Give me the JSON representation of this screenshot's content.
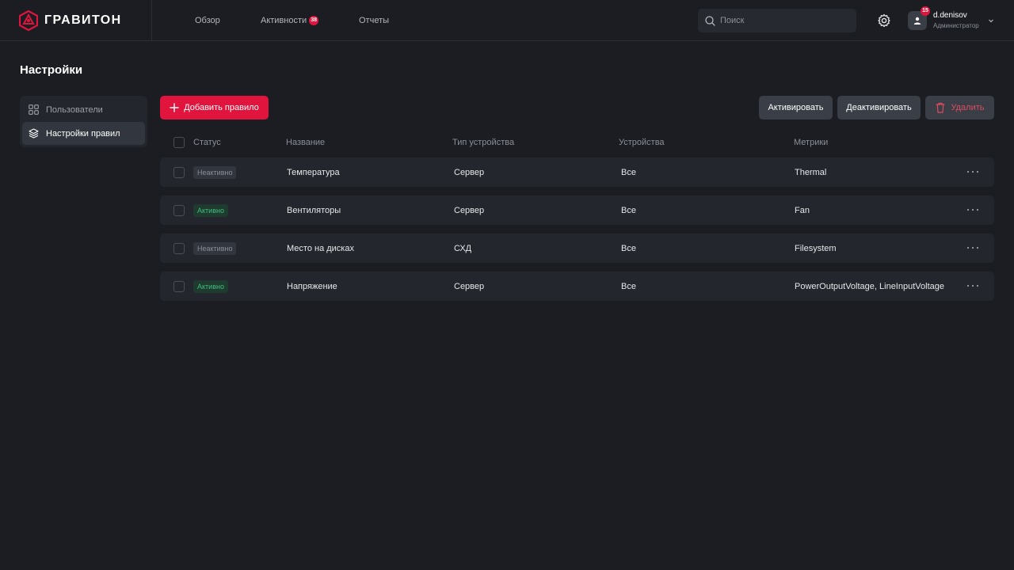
{
  "app": {
    "logo_text": "ГРАВИТОН"
  },
  "header": {
    "nav": [
      {
        "label": "Обзор"
      },
      {
        "label": "Активности",
        "badge": "38"
      },
      {
        "label": "Отчеты"
      }
    ],
    "search": {
      "placeholder": "Поиск"
    },
    "user": {
      "name": "d.denisov",
      "role": "Администратор",
      "badge": "15"
    }
  },
  "page": {
    "title": "Настройки"
  },
  "sidebar": {
    "items": [
      {
        "label": "Пользователи",
        "icon": "grid-icon",
        "active": false
      },
      {
        "label": "Настройки правил",
        "icon": "layers-icon",
        "active": true
      }
    ]
  },
  "toolbar": {
    "add_label": "Добавить правило",
    "activate_label": "Активировать",
    "deactivate_label": "Деактивировать",
    "delete_label": "Удалить"
  },
  "table": {
    "columns": {
      "status": "Статус",
      "name": "Название",
      "device_type": "Тип устройства",
      "devices": "Устройства",
      "metrics": "Метрики"
    },
    "rows": [
      {
        "status": "Неактивно",
        "status_kind": "inactive",
        "name": "Температура",
        "device_type": "Сервер",
        "devices": "Все",
        "metrics": "Thermal"
      },
      {
        "status": "Активно",
        "status_kind": "active",
        "name": "Вентиляторы",
        "device_type": "Сервер",
        "devices": "Все",
        "metrics": "Fan"
      },
      {
        "status": "Неактивно",
        "status_kind": "inactive",
        "name": "Место на дисках",
        "device_type": "СХД",
        "devices": "Все",
        "metrics": "Filesystem"
      },
      {
        "status": "Активно",
        "status_kind": "active",
        "name": "Напряжение",
        "device_type": "Сервер",
        "devices": "Все",
        "metrics": "PowerOutputVoltage, LineInputVoltage"
      }
    ]
  },
  "colors": {
    "accent": "#e0143c",
    "background": "#1b1d22",
    "surface": "#23262c",
    "active_status": "#3fbf7f"
  }
}
